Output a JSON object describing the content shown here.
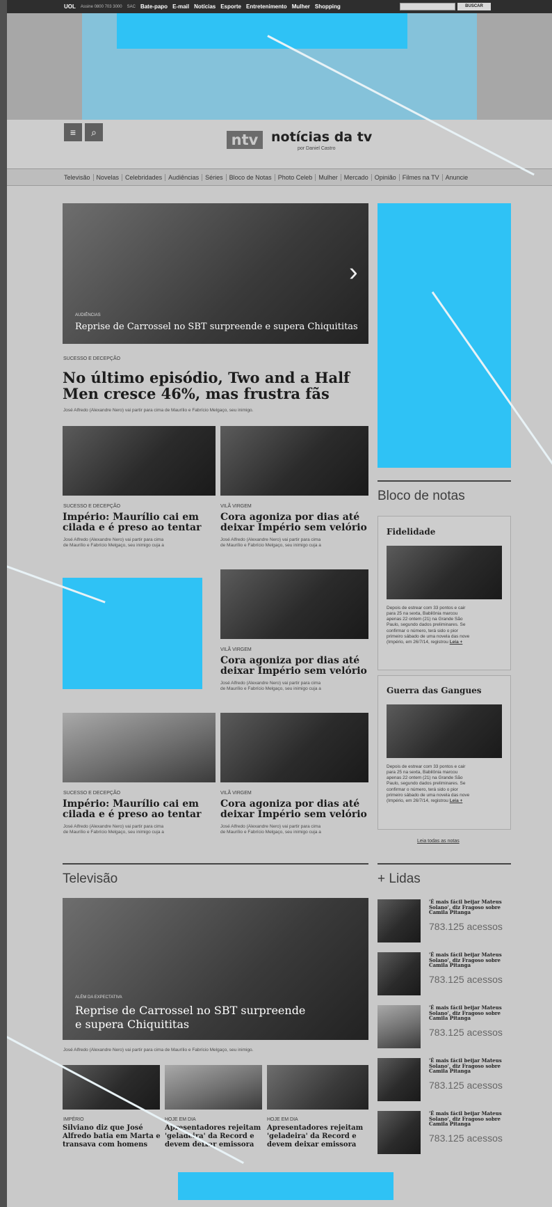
{
  "topbar": {
    "brand": "UOL",
    "assine": "Assine 0800 703 3000",
    "sac": "SAC",
    "links": [
      "Bate-papo",
      "E-mail",
      "Notícias",
      "Esporte",
      "Entretenimento",
      "Mulher",
      "Shopping"
    ],
    "search_button": "BUSCAR"
  },
  "header": {
    "logo_mark": "ntv",
    "site_title": "notícias da tv",
    "site_subtitle": "por Daniel Castro"
  },
  "nav": {
    "items": [
      "Televisão",
      "Novelas",
      "Celebridades",
      "Audiências",
      "Séries",
      "Bloco de Notas",
      "Photo Celeb",
      "Mulher",
      "Mercado",
      "Opinião",
      "Filmes na TV",
      "Anuncie"
    ]
  },
  "hero": {
    "tag": "Audiências",
    "title": "Reprise de Carrossel no SBT surpreende e supera Chiquititas"
  },
  "lead": {
    "kicker": "Sucesso e decepção",
    "headline_line1": "No último episódio, Two and a Half",
    "headline_line2": "Men cresce 46%, mas frustra fãs",
    "body": "José Alfredo (Alexandre Nero) vai partir para cima de Maurílio e Fabrício Melgaço, seu inimigo."
  },
  "articles": [
    {
      "kicker": "Sucesso e decepção",
      "line1": "Império: Maurílio cai em",
      "line2": "cilada e é preso ao tentar",
      "b1": "José Alfredo (Alexandre Nero) vai partir para cima",
      "b2": "de Maurílio e Fabrício Melgaço, seu inimigo cuja a"
    },
    {
      "kicker": "Vilã virgem",
      "line1": "Cora agoniza por dias até",
      "line2": "deixar Império sem velório",
      "b1": "José Alfredo (Alexandre Nero) vai partir para cima",
      "b2": "de Maurílio e Fabrício Melgaço, seu inimigo cuja a"
    },
    {
      "kicker": "Vilã virgem",
      "line1": "Cora agoniza por dias até",
      "line2": "deixar Império sem velório",
      "b1": "José Alfredo (Alexandre Nero) vai partir para cima",
      "b2": "de Maurílio e Fabrício Melgaço, seu inimigo cuja a"
    },
    {
      "kicker": "Sucesso e decepção",
      "line1": "Império: Maurílio cai em",
      "line2": "cilada e é preso ao tentar",
      "b1": "José Alfredo (Alexandre Nero) vai partir para cima",
      "b2": "de Maurílio e Fabrício Melgaço, seu inimigo cuja a"
    },
    {
      "kicker": "Vilã virgem",
      "line1": "Cora agoniza por dias até",
      "line2": "deixar Império sem velório",
      "b1": "José Alfredo (Alexandre Nero) vai partir para cima",
      "b2": "de Maurílio e Fabrício Melgaço, seu inimigo cuja a"
    }
  ],
  "bloco": {
    "heading": "Bloco de notas",
    "cards": [
      {
        "title": "Fidelidade",
        "lines": [
          "Depois de estrear com 33 pontos e cair",
          "para 25 na sexta, Babilônia marcou",
          "apenas 22 ontem (21) na Grande São",
          "Paulo, segundo dados preliminares. Se",
          "confirmar o número, terá sido o pior",
          "primeiro sábado de uma novela das nove",
          "(Império, em 26/7/14, registrou"
        ],
        "more": "Leia +"
      },
      {
        "title": "Guerra das Gangues",
        "lines": [
          "Depois de estrear com 33 pontos e cair",
          "para 25 na sexta, Babilônia marcou",
          "apenas 22 ontem (21) na Grande São",
          "Paulo, segundo dados preliminares. Se",
          "confirmar o número, terá sido o pior",
          "primeiro sábado de uma novela das nove",
          "(Império, em 26/7/14, registrou"
        ],
        "more": "Leia +"
      }
    ],
    "all_link": "Leia todas as notas"
  },
  "televisao": {
    "heading": "Televisão",
    "feature_tag": "Além da expectativa",
    "feature_line1": "Reprise de Carrossel no SBT surpreende",
    "feature_line2": "e supera Chiquititas",
    "body": "José Alfredo (Alexandre Nero) vai partir para cima de Maurílio e Fabrício Melgaço, seu inimigo.",
    "items": [
      {
        "kicker": "Império",
        "l1": "Silviano diz que José",
        "l2": "Alfredo batia em Marta e",
        "l3": "transava com homens"
      },
      {
        "kicker": "Hoje em dia",
        "l1": "Apresentadores rejeitam",
        "l2": "'geladeira' da Record e",
        "l3": "devem deixar emissora"
      },
      {
        "kicker": "Hoje em dia",
        "l1": "Apresentadores rejeitam",
        "l2": "'geladeira' da Record e",
        "l3": "devem deixar emissora"
      }
    ]
  },
  "lidas": {
    "heading": "+ Lidas",
    "items": [
      {
        "l1": "'É mais fácil beijar Mateus",
        "l2": "Solano', diz Fragoso sobre",
        "l3": "Camila Pitanga",
        "count": "783.125 acessos"
      },
      {
        "l1": "'É mais fácil beijar Mateus",
        "l2": "Solano', diz Fragoso sobre",
        "l3": "Camila Pitanga",
        "count": "783.125 acessos"
      },
      {
        "l1": "'É mais fácil beijar Mateus",
        "l2": "Solano', diz Fragoso sobre",
        "l3": "Camila Pitanga",
        "count": "783.125 acessos"
      },
      {
        "l1": "'É mais fácil beijar Mateus",
        "l2": "Solano', diz Fragoso sobre",
        "l3": "Camila Pitanga",
        "count": "783.125 acessos"
      },
      {
        "l1": "'É mais fácil beijar Mateus",
        "l2": "Solano', diz Fragoso sobre",
        "l3": "Camila Pitanga",
        "count": "783.125 acessos"
      }
    ]
  },
  "colors": {
    "ad_placeholder": "#2fc2f5",
    "page_bg": "#c9c9c9",
    "frame_bg": "#4f4f4f"
  }
}
